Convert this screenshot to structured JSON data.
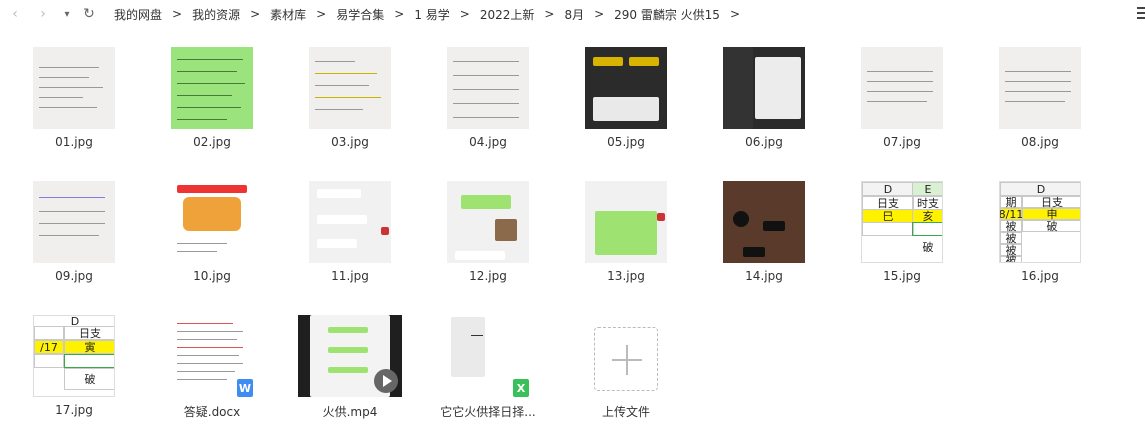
{
  "toolbar": {
    "back": "‹",
    "forward": "›",
    "dropdown": "▾",
    "refresh": "↻",
    "breadcrumb": [
      "我的网盘",
      "我的资源",
      "素材库",
      "易学合集",
      "1 易学",
      "2022上新",
      "8月",
      "290 雷麟宗 火供15"
    ],
    "separator": ">"
  },
  "files": [
    {
      "name": "01.jpg",
      "kind": "notes"
    },
    {
      "name": "02.jpg",
      "kind": "green"
    },
    {
      "name": "03.jpg",
      "kind": "notes"
    },
    {
      "name": "04.jpg",
      "kind": "notes"
    },
    {
      "name": "05.jpg",
      "kind": "dark"
    },
    {
      "name": "06.jpg",
      "kind": "dark"
    },
    {
      "name": "07.jpg",
      "kind": "notes"
    },
    {
      "name": "08.jpg",
      "kind": "notes"
    },
    {
      "name": "09.jpg",
      "kind": "notes"
    },
    {
      "name": "10.jpg",
      "kind": "promo"
    },
    {
      "name": "11.jpg",
      "kind": "chat"
    },
    {
      "name": "12.jpg",
      "kind": "chat"
    },
    {
      "name": "13.jpg",
      "kind": "chat"
    },
    {
      "name": "14.jpg",
      "kind": "photo"
    },
    {
      "name": "15.jpg",
      "kind": "sheet"
    },
    {
      "name": "16.jpg",
      "kind": "sheet"
    },
    {
      "name": "17.jpg",
      "kind": "sheet"
    },
    {
      "name": "答疑.docx",
      "kind": "docx"
    },
    {
      "name": "火供.mp4",
      "kind": "video"
    },
    {
      "name": "它它火供择日择...",
      "kind": "xlsx"
    },
    {
      "name": "上传文件",
      "kind": "upload"
    }
  ],
  "sheet15": {
    "col": "D",
    "col2": "E",
    "h1": "日支",
    "h2": "时支",
    "r1a": "巳",
    "r1b": "亥",
    "r2": "破"
  },
  "sheet16": {
    "col": "D",
    "left": "期",
    "h": "日支",
    "date": "8/11",
    "r1": "申",
    "r2": "破",
    "side": [
      "被",
      "被",
      "被",
      "被"
    ]
  },
  "sheet17": {
    "col": "D",
    "h": "日支",
    "date": "/17",
    "r1": "寅",
    "r2": "破"
  },
  "colors": {
    "docx_badge": "#3f8cf2",
    "xlsx_badge": "#39c05a",
    "highlight": "#fff200",
    "green_col": "#d9f0d3"
  },
  "badges": {
    "docx": "W",
    "xlsx": "X"
  }
}
